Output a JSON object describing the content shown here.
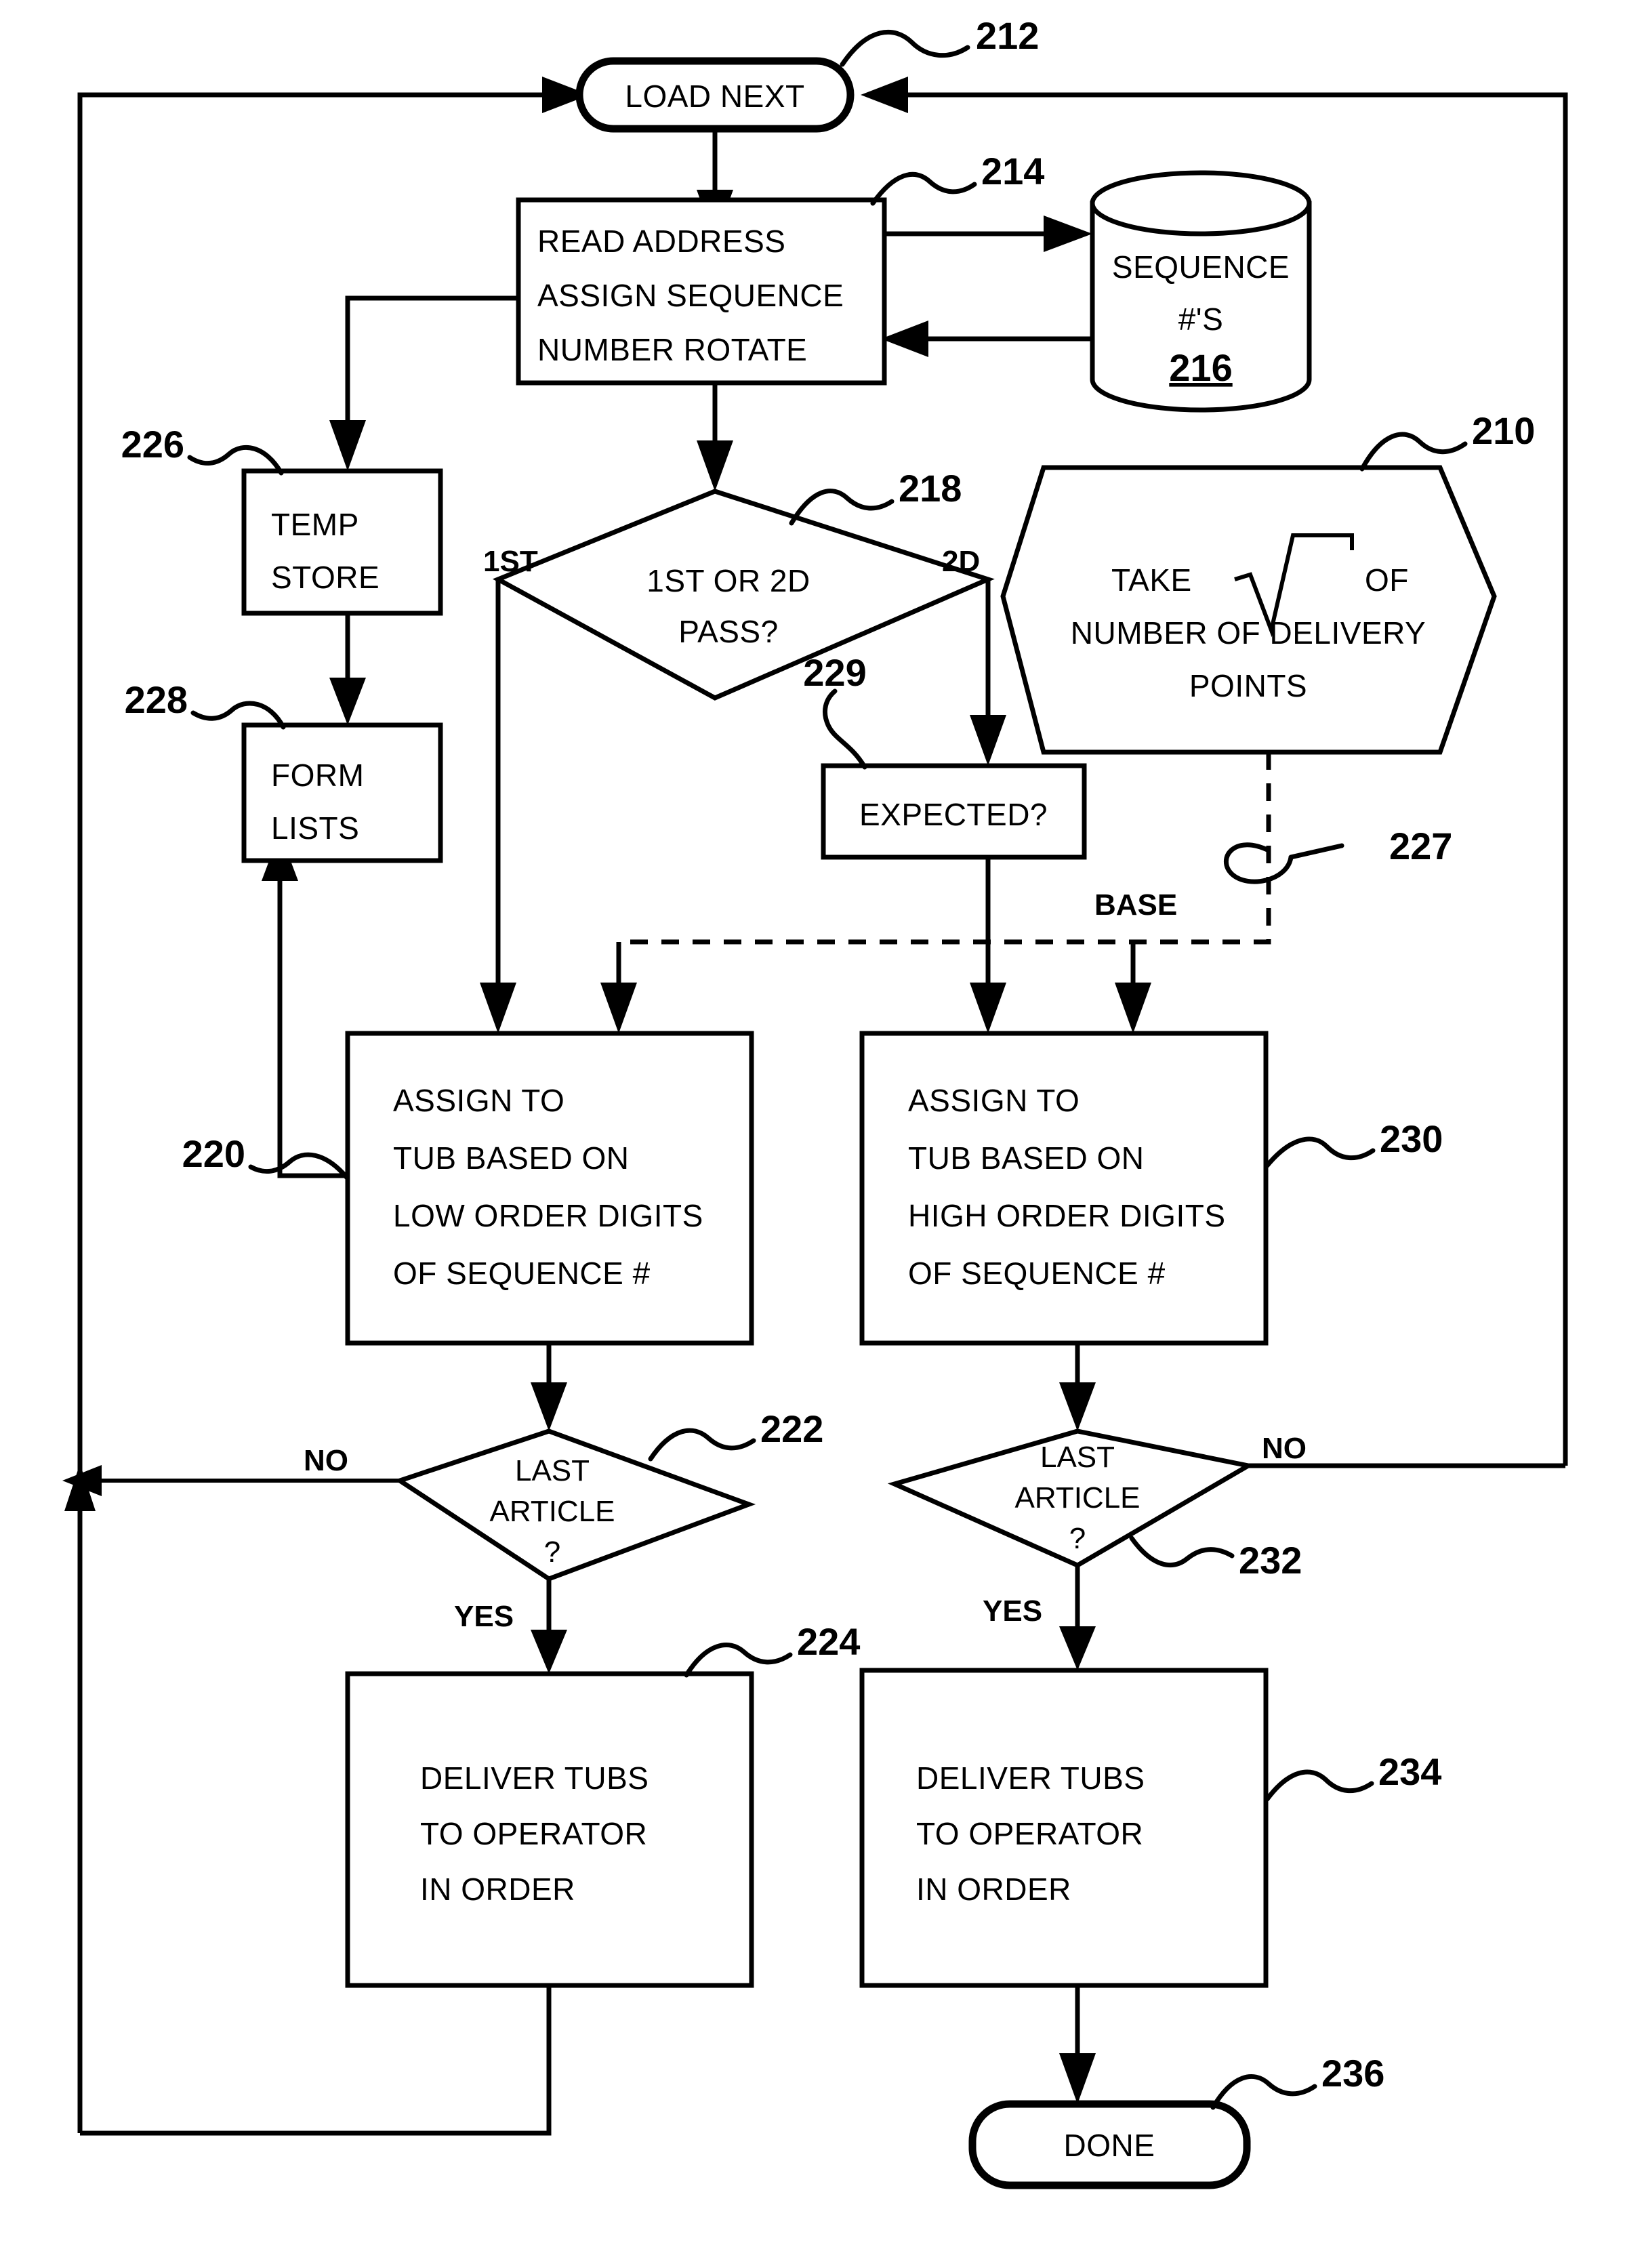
{
  "figure": {
    "type": "patent-flowchart",
    "background": "#ffffff",
    "ink": "#000000"
  },
  "nodes": {
    "load_next": {
      "label": "LOAD NEXT",
      "ref": "212",
      "shape": "rounded-terminator"
    },
    "read_address": {
      "line1": "READ ADDRESS",
      "line2": "ASSIGN SEQUENCE",
      "line3": "NUMBER ROTATE",
      "ref": "214",
      "shape": "process"
    },
    "sequence_store": {
      "line1": "SEQUENCE",
      "line2": "#'S",
      "ref": "216",
      "shape": "cylinder-database"
    },
    "pass_decision": {
      "line1": "1ST OR 2D",
      "line2": "PASS?",
      "ref": "218",
      "shape": "decision-diamond",
      "branch_left": "1ST",
      "branch_right": "2D"
    },
    "sqrt_hexagon": {
      "line1_prefix": "TAKE",
      "line1_symbol": "√",
      "line1_suffix": "OF",
      "line2": "NUMBER OF DELIVERY",
      "line3": "POINTS",
      "ref": "210",
      "shape": "hexagon"
    },
    "temp_store": {
      "line1": "TEMP",
      "line2": "STORE",
      "ref": "226",
      "shape": "process"
    },
    "form_lists": {
      "line1": "FORM",
      "line2": "LISTS",
      "ref": "228",
      "shape": "process"
    },
    "expected": {
      "label": "EXPECTED?",
      "ref": "229",
      "shape": "process"
    },
    "assign_low": {
      "line1": "ASSIGN TO",
      "line2": "TUB BASED ON",
      "line3": "LOW ORDER DIGITS",
      "line4": "OF SEQUENCE #",
      "ref": "220",
      "shape": "process"
    },
    "assign_high": {
      "line1": "ASSIGN TO",
      "line2": "TUB BASED ON",
      "line3": "HIGH ORDER DIGITS",
      "line4": "OF SEQUENCE #",
      "ref": "230",
      "shape": "process"
    },
    "last_article_left": {
      "line1": "LAST",
      "line2": "ARTICLE",
      "line3": "?",
      "ref": "222",
      "shape": "decision-diamond",
      "branch_no": "NO",
      "branch_yes": "YES"
    },
    "last_article_right": {
      "line1": "LAST",
      "line2": "ARTICLE",
      "line3": "?",
      "ref": "232",
      "shape": "decision-diamond",
      "branch_no": "NO",
      "branch_yes": "YES"
    },
    "deliver_left": {
      "line1": "DELIVER TUBS",
      "line2": "TO OPERATOR",
      "line3": "IN ORDER",
      "ref": "224",
      "shape": "process"
    },
    "deliver_right": {
      "line1": "DELIVER TUBS",
      "line2": "TO OPERATOR",
      "line3": "IN ORDER",
      "ref": "234",
      "shape": "process"
    },
    "done": {
      "label": "DONE",
      "ref": "236",
      "shape": "rounded-terminator"
    }
  },
  "edge_labels": {
    "base": "BASE",
    "base_ref": "227"
  }
}
